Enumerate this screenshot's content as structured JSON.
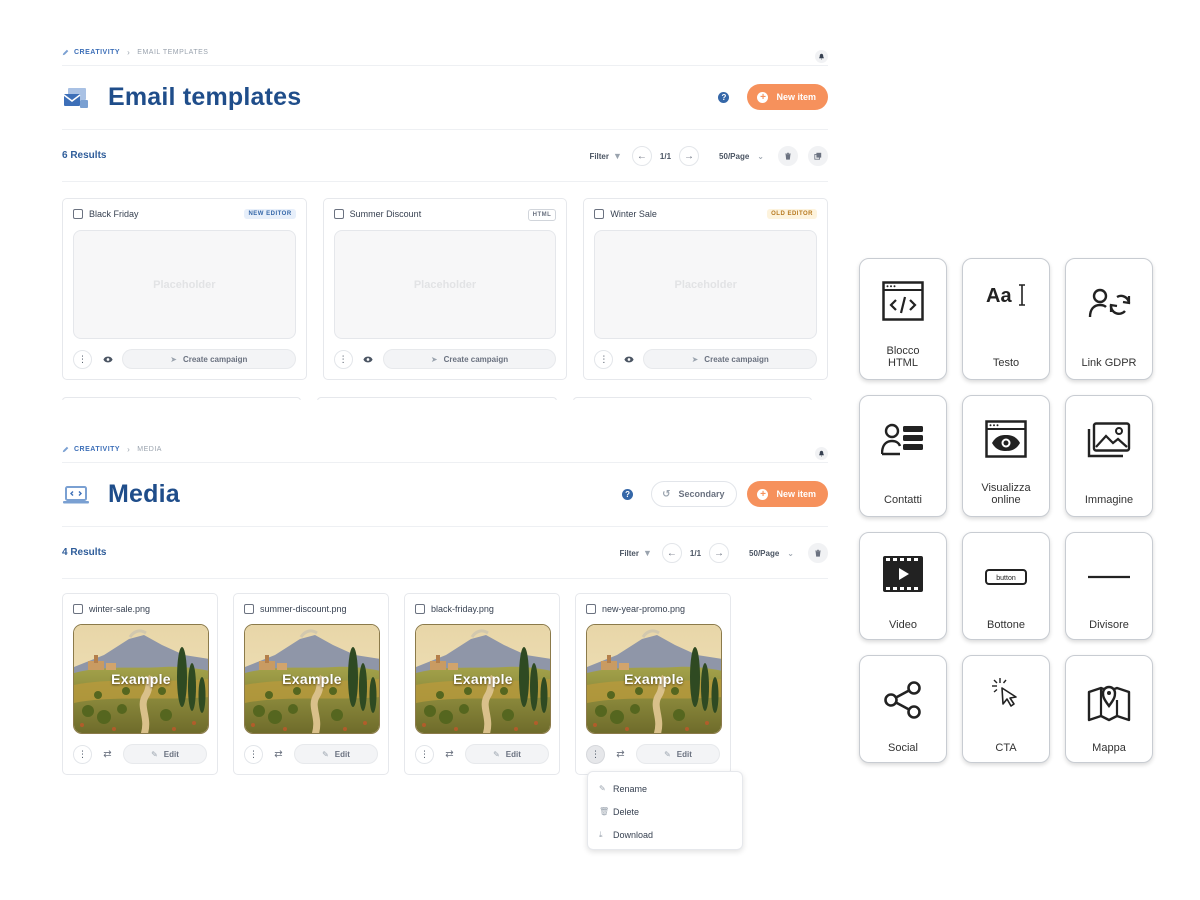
{
  "email_panel": {
    "breadcrumb": {
      "root": "CREATIVITY",
      "current": "EMAIL TEMPLATES"
    },
    "title": "Email templates",
    "new_button": "New item",
    "results": "6 Results",
    "filter": "Filter",
    "page": "1/1",
    "per_page": "50/Page",
    "templates": [
      {
        "name": "Black Friday",
        "badge": "NEW EDITOR",
        "placeholder": "Placeholder",
        "action": "Create campaign"
      },
      {
        "name": "Summer Discount",
        "badge": "HTML",
        "placeholder": "Placeholder",
        "action": "Create campaign"
      },
      {
        "name": "Winter Sale",
        "badge": "OLD EDITOR",
        "placeholder": "Placeholder",
        "action": "Create campaign"
      }
    ]
  },
  "media_panel": {
    "breadcrumb": {
      "root": "CREATIVITY",
      "current": "MEDIA"
    },
    "title": "Media",
    "secondary_button": "Secondary",
    "new_button": "New item",
    "results": "4 Results",
    "filter": "Filter",
    "page": "1/1",
    "per_page": "50/Page",
    "files": [
      {
        "name": "winter-sale.png",
        "image_text": "Example",
        "action": "Edit"
      },
      {
        "name": "summer-discount.png",
        "image_text": "Example",
        "action": "Edit"
      },
      {
        "name": "black-friday.png",
        "image_text": "Example",
        "action": "Edit"
      },
      {
        "name": "new-year-promo.png",
        "image_text": "Example",
        "action": "Edit"
      }
    ],
    "context_menu": [
      "Rename",
      "Delete",
      "Download"
    ]
  },
  "blocks": [
    {
      "label_1": "Blocco",
      "label_2": "HTML",
      "icon": "html-code-icon"
    },
    {
      "label_1": "Testo",
      "label_2": "",
      "icon": "text-icon"
    },
    {
      "label_1": "Link GDPR",
      "label_2": "",
      "icon": "user-sync-icon"
    },
    {
      "label_1": "Contatti",
      "label_2": "",
      "icon": "contacts-icon"
    },
    {
      "label_1": "Visualizza",
      "label_2": "online",
      "icon": "browser-eye-icon"
    },
    {
      "label_1": "Immagine",
      "label_2": "",
      "icon": "image-icon"
    },
    {
      "label_1": "Video",
      "label_2": "",
      "icon": "video-icon"
    },
    {
      "label_1": "Bottone",
      "label_2": "",
      "icon": "button-icon"
    },
    {
      "label_1": "Divisore",
      "label_2": "",
      "icon": "divider-icon"
    },
    {
      "label_1": "Social",
      "label_2": "",
      "icon": "share-icon"
    },
    {
      "label_1": "CTA",
      "label_2": "",
      "icon": "cursor-click-icon"
    },
    {
      "label_1": "Mappa",
      "label_2": "",
      "icon": "map-icon"
    }
  ],
  "colors": {
    "accent": "#f6915c",
    "brand": "#1f4d8a",
    "link": "#3d6fb8"
  }
}
